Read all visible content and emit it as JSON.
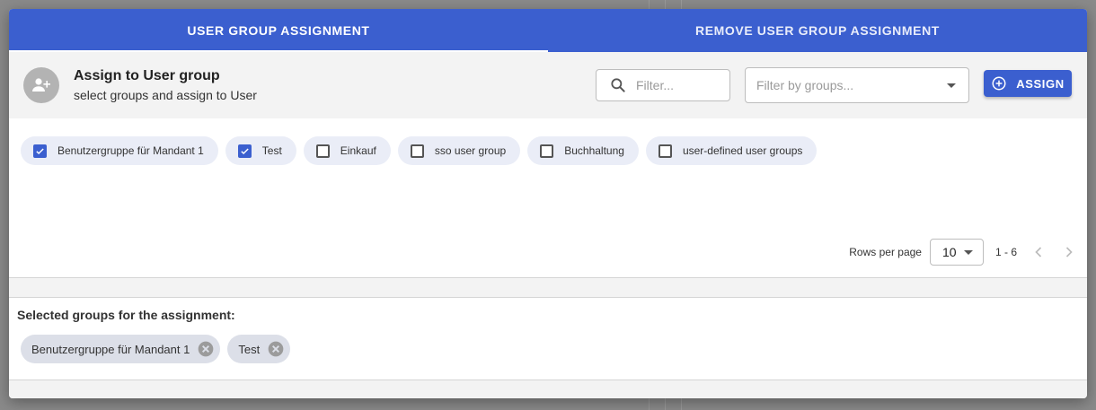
{
  "tabs": [
    {
      "label": "USER GROUP ASSIGNMENT",
      "active": true
    },
    {
      "label": "REMOVE USER GROUP ASSIGNMENT",
      "active": false
    }
  ],
  "header": {
    "icon": "group-add-icon",
    "title": "Assign to User group",
    "subtitle": "select groups and assign to User"
  },
  "filter": {
    "placeholder": "Filter...",
    "icon": "search-icon"
  },
  "group_filter": {
    "placeholder": "Filter by groups..."
  },
  "assign_button": {
    "label": "ASSIGN",
    "icon": "add-circle-icon"
  },
  "groups": [
    {
      "label": "Benutzergruppe für Mandant 1",
      "checked": true
    },
    {
      "label": "Test",
      "checked": true
    },
    {
      "label": "Einkauf",
      "checked": false
    },
    {
      "label": "sso user group",
      "checked": false
    },
    {
      "label": "Buchhaltung",
      "checked": false
    },
    {
      "label": "user-defined user groups",
      "checked": false
    }
  ],
  "pagination": {
    "rows_per_page_label": "Rows per page",
    "rows_per_page": "10",
    "range": "1 - 6"
  },
  "selected": {
    "label": "Selected groups for the assignment:",
    "items": [
      "Benutzergruppe für Mandant 1",
      "Test"
    ]
  },
  "colors": {
    "accent": "#3b5fcf",
    "chip_bg": "#eaedf7"
  }
}
